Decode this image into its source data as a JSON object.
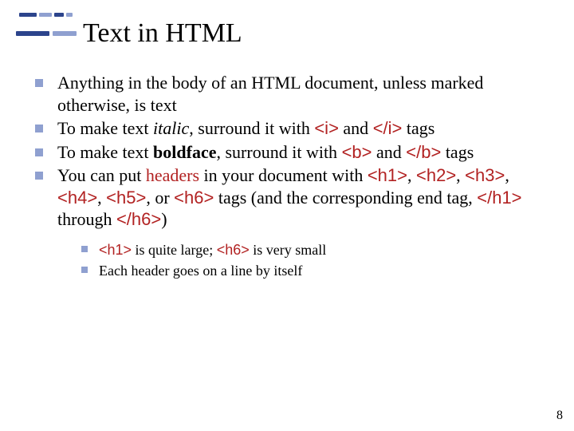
{
  "title": "Text in HTML",
  "bullets": {
    "b1": "Anything in the body of an HTML document, unless marked otherwise, is text",
    "b2_pre": "To make text ",
    "b2_italic": "italic",
    "b2_mid": ", surround it with ",
    "b2_code1": "<i>",
    "b2_and": " and ",
    "b2_code2": "</i>",
    "b2_post": " tags",
    "b3_pre": "To make text ",
    "b3_bold": "boldface",
    "b3_mid": ", surround it with ",
    "b3_code1": "<b>",
    "b3_and": " and ",
    "b3_code2": "</b>",
    "b3_post": " tags",
    "b4_pre": "You can put ",
    "b4_red": "headers",
    "b4_mid1": " in your document with ",
    "b4_c1": "<h1>",
    "b4_sep1": ", ",
    "b4_c2": "<h2>",
    "b4_sep2": ", ",
    "b4_c3": "<h3>",
    "b4_sep3": ", ",
    "b4_c4": "<h4>",
    "b4_sep4": ", ",
    "b4_c5": "<h5>",
    "b4_sep5": ", or ",
    "b4_c6": "<h6>",
    "b4_mid2": " tags (and the corresponding end tag, ",
    "b4_c7": "</h1>",
    "b4_mid3": " through ",
    "b4_c8": "</h6>",
    "b4_post": ")"
  },
  "sub": {
    "s1_c1": "<h1>",
    "s1_mid": " is quite large; ",
    "s1_c2": "<h6>",
    "s1_post": " is very small",
    "s2": "Each header goes on a line by itself"
  },
  "page_number": "8"
}
